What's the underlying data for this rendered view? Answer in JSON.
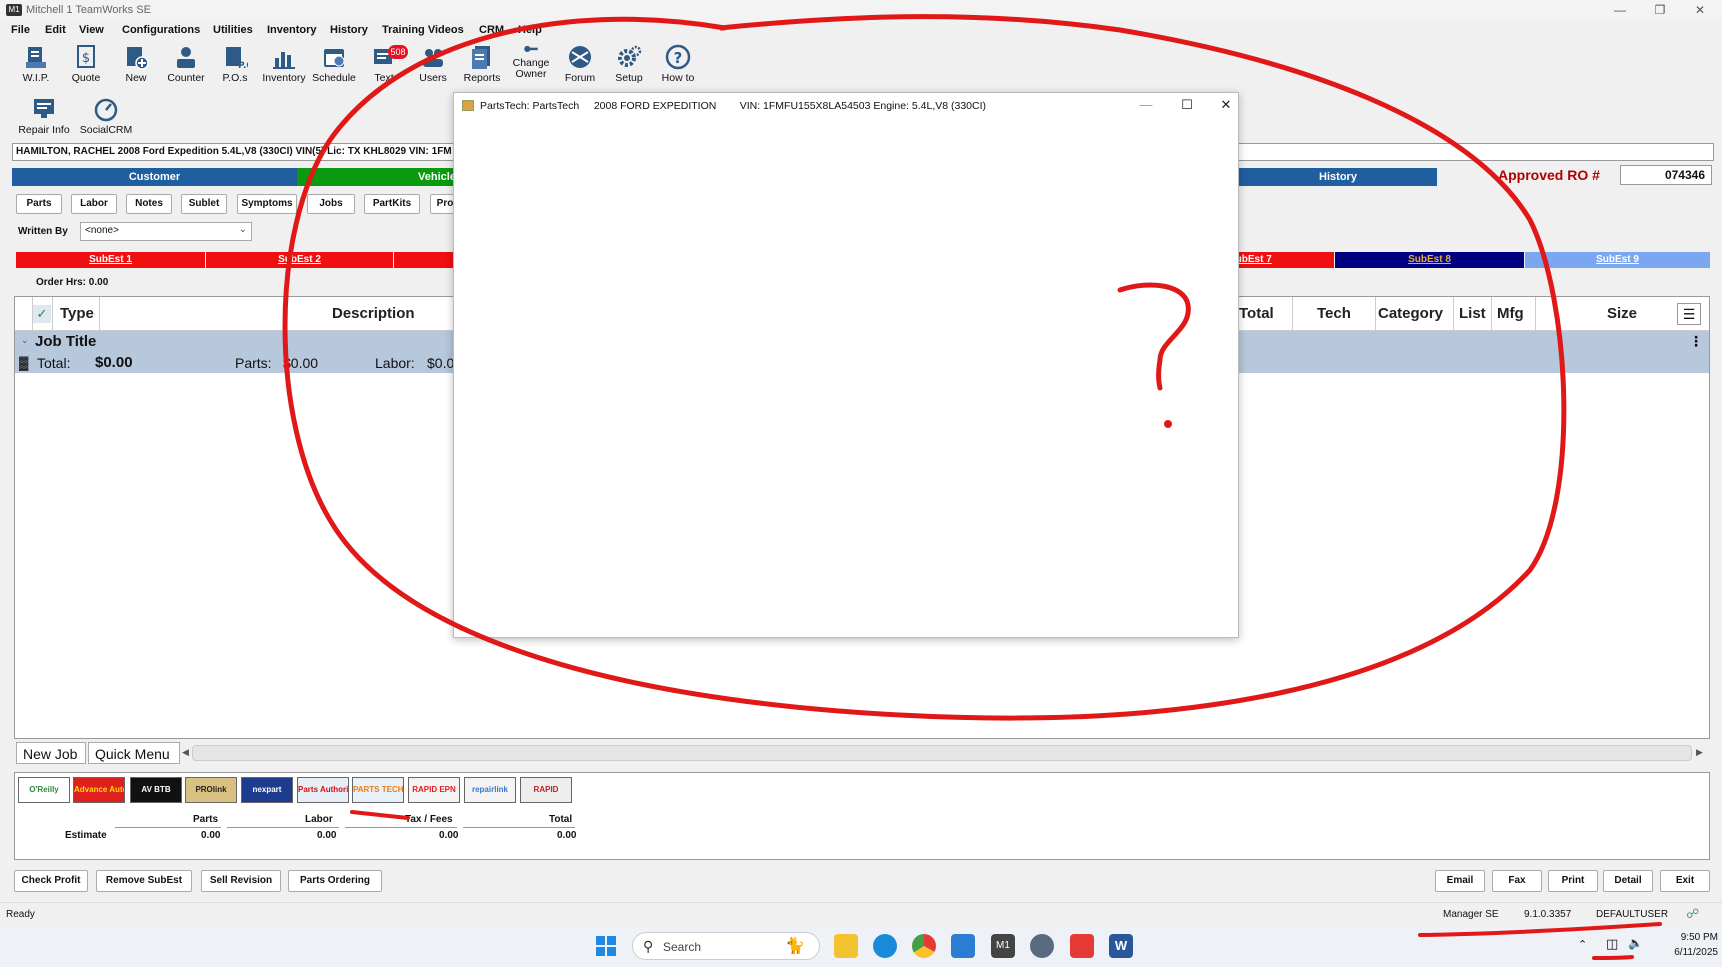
{
  "window": {
    "title": "Mitchell 1 TeamWorks SE",
    "icon": "mitchell-logo"
  },
  "menu": [
    "File",
    "Edit",
    "View",
    "Configurations",
    "Utilities",
    "Inventory",
    "History",
    "Training Videos",
    "CRM",
    "Help"
  ],
  "toolbar": [
    {
      "label": "W.I.P.",
      "icon": "wip-icon"
    },
    {
      "label": "Quote",
      "icon": "quote-icon"
    },
    {
      "label": "New",
      "icon": "new-icon"
    },
    {
      "label": "Counter",
      "icon": "counter-icon"
    },
    {
      "label": "P.O.s",
      "icon": "po-icon"
    },
    {
      "label": "Inventory",
      "icon": "inventory-icon"
    },
    {
      "label": "Schedule",
      "icon": "schedule-icon"
    },
    {
      "label": "Text",
      "icon": "text-icon"
    },
    {
      "label": "Users",
      "icon": "users-icon"
    },
    {
      "label": "Reports",
      "icon": "reports-icon"
    },
    {
      "label": "Change Owner",
      "icon": "key-icon"
    },
    {
      "label": "Forum",
      "icon": "forum-icon"
    },
    {
      "label": "Setup",
      "icon": "gear-icon"
    },
    {
      "label": "How to",
      "icon": "help-icon"
    }
  ],
  "text_badge": "508",
  "toolbar2": [
    {
      "label": "Repair Info",
      "icon": "repair-info-icon"
    },
    {
      "label": "SocialCRM",
      "icon": "gauge-icon"
    }
  ],
  "customer_bar": "HAMILTON, RACHEL   2008  Ford Expedition   5.4L,V8 (330CI) VIN(5) Lic: TX KHL8029  VIN: 1FM",
  "main_tabs": {
    "customer": "Customer",
    "vehicle": "Vehicle",
    "history": "History"
  },
  "approved_ro": {
    "label": "Approved RO #",
    "value": "074346"
  },
  "sub_tabs": [
    "Parts",
    "Labor",
    "Notes",
    "Sublet",
    "Symptoms",
    "Jobs",
    "PartKits",
    "Pro"
  ],
  "written_by": {
    "label": "Written By",
    "value": "<none>"
  },
  "subestimates": [
    {
      "label": "SubEst 1",
      "color": "#f01010"
    },
    {
      "label": "SubEst 2",
      "color": "#f01010"
    },
    {
      "label": "",
      "color": "#f01010"
    },
    {
      "label": "SubEst 7",
      "color": "#f01010"
    },
    {
      "label": "SubEst 8",
      "color": "#000080"
    },
    {
      "label": "SubEst 9",
      "color": "#7aa7f0"
    }
  ],
  "order_hrs": "Order Hrs: 0.00",
  "grid": {
    "columns_left": [
      "Type",
      "Description"
    ],
    "columns_right": [
      "Total",
      "Tech",
      "Category",
      "List",
      "Mfg",
      "Size"
    ],
    "job_title": "Job Title",
    "total_label": "Total:",
    "total_value": "$0.00",
    "parts_label": "Parts:",
    "parts_value": "$0.00",
    "labor_label": "Labor:",
    "labor_value": "$0.0"
  },
  "bottom_tabs": [
    "New Job",
    "Quick Menu"
  ],
  "vendors": [
    {
      "name": "O'Reilly",
      "color": "#2d8a3a",
      "bg": "#fff"
    },
    {
      "name": "Advance Auto Parts",
      "color": "#ffdd00",
      "bg": "#e0201c"
    },
    {
      "name": "AV BTB",
      "color": "#fff",
      "bg": "#111"
    },
    {
      "name": "PROlink",
      "color": "#222",
      "bg": "#d8c080"
    },
    {
      "name": "nexpart",
      "color": "#fff",
      "bg": "#1d3c8f"
    },
    {
      "name": "Parts Authority IMC WW",
      "color": "#d01010",
      "bg": "#e8eef8"
    },
    {
      "name": "PARTS TECH",
      "color": "#f07a10",
      "bg": "#e8f0fa"
    },
    {
      "name": "RAPID EPN",
      "color": "#e02020",
      "bg": "#f4f4f4"
    },
    {
      "name": "repairlink",
      "color": "#3a78c8",
      "bg": "#f4f4f4"
    },
    {
      "name": "RAPID",
      "color": "#c02020",
      "bg": "#eee"
    }
  ],
  "summary": {
    "headers": [
      "Parts",
      "Labor",
      "Tax / Fees",
      "Total"
    ],
    "row_label": "Estimate",
    "values": [
      "0.00",
      "0.00",
      "0.00",
      "0.00"
    ]
  },
  "actions_left": [
    "Check Profit",
    "Remove SubEst",
    "Sell Revision",
    "Parts Ordering"
  ],
  "actions_right": [
    "Email",
    "Fax",
    "Print",
    "Detail",
    "Exit"
  ],
  "status": {
    "left": "Ready",
    "role": "Manager SE",
    "version": "9.1.0.3357",
    "user": "DEFAULTUSER"
  },
  "taskbar": {
    "search": "Search",
    "time": "9:50 PM",
    "date": "6/11/2025"
  },
  "dialog": {
    "title": "PartsTech: PartsTech",
    "vehicle": "2008 FORD EXPEDITION",
    "vin": "VIN: 1FMFU155X8LA54503 Engine: 5.4L,V8 (330CI)"
  },
  "annotation": {
    "mark": "?",
    "color": "#e01818"
  }
}
